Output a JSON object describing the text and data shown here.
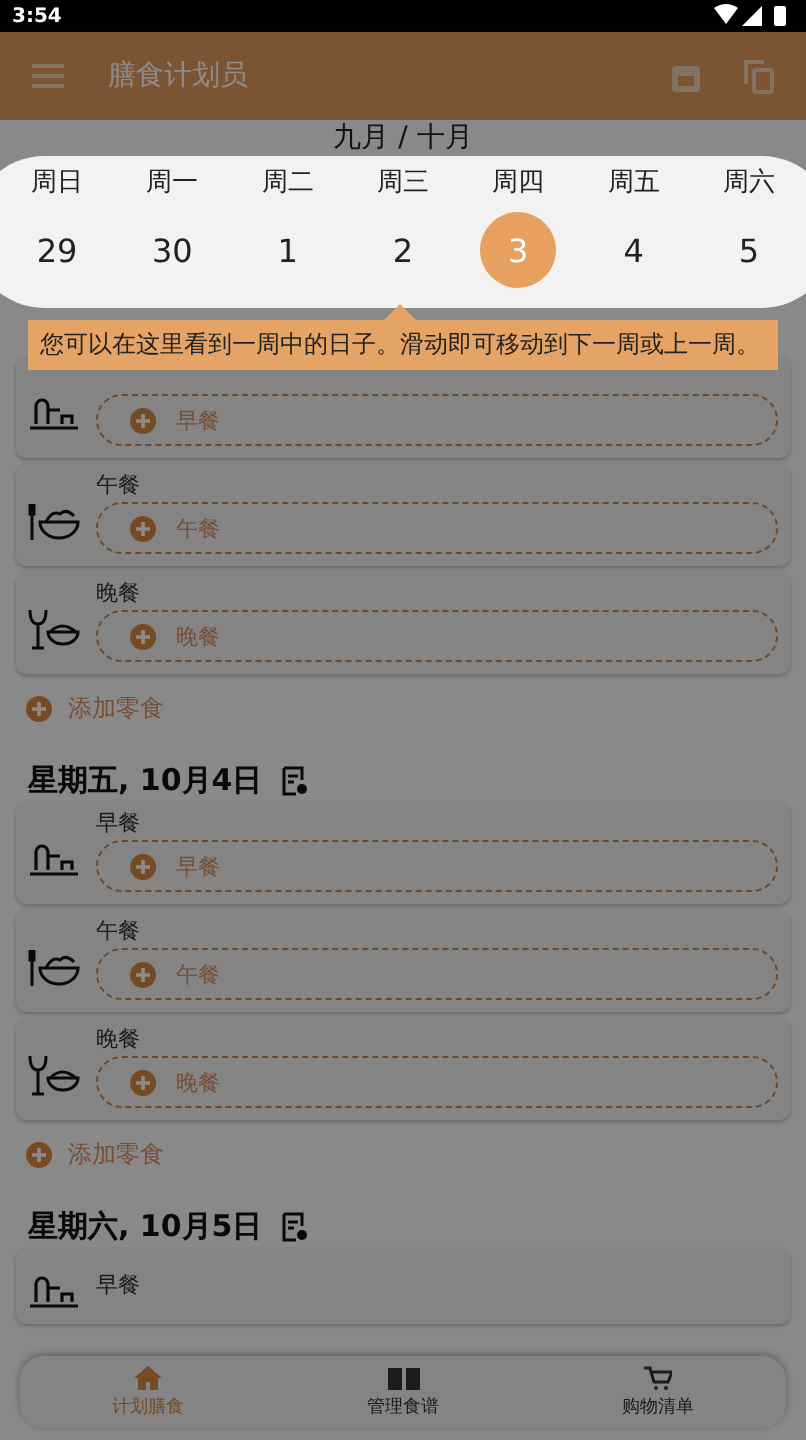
{
  "status_bar": {
    "time": "3:54"
  },
  "app_bar": {
    "title": "膳食计划员"
  },
  "week": {
    "month": "九月 / 十月",
    "days": [
      {
        "weekday": "周日",
        "date": "29",
        "selected": false
      },
      {
        "weekday": "周一",
        "date": "30",
        "selected": false
      },
      {
        "weekday": "周二",
        "date": "1",
        "selected": false
      },
      {
        "weekday": "周三",
        "date": "2",
        "selected": false
      },
      {
        "weekday": "周四",
        "date": "3",
        "selected": true
      },
      {
        "weekday": "周五",
        "date": "4",
        "selected": false
      },
      {
        "weekday": "周六",
        "date": "5",
        "selected": false
      }
    ]
  },
  "tooltip": "您可以在这里看到一周中的日子。滑动即可移动到下一周或上一周。",
  "days": [
    {
      "meals": [
        {
          "kind": "breakfast",
          "add_label": "早餐"
        },
        {
          "kind": "lunch",
          "label": "午餐",
          "add_label": "午餐"
        },
        {
          "kind": "dinner",
          "label": "晚餐",
          "add_label": "晚餐"
        }
      ],
      "add_snack": "添加零食"
    },
    {
      "heading": "星期五, 10月4日",
      "meals": [
        {
          "kind": "breakfast",
          "label": "早餐",
          "add_label": "早餐"
        },
        {
          "kind": "lunch",
          "label": "午餐",
          "add_label": "午餐"
        },
        {
          "kind": "dinner",
          "label": "晚餐",
          "add_label": "晚餐"
        }
      ],
      "add_snack": "添加零食"
    },
    {
      "heading": "星期六, 10月5日",
      "meals": [
        {
          "kind": "breakfast",
          "label": "早餐"
        }
      ]
    }
  ],
  "bottom_nav": [
    {
      "kind": "home",
      "label": "计划膳食",
      "selected": true
    },
    {
      "kind": "book",
      "label": "管理食谱",
      "selected": false
    },
    {
      "kind": "cart",
      "label": "购物清单",
      "selected": false
    }
  ]
}
